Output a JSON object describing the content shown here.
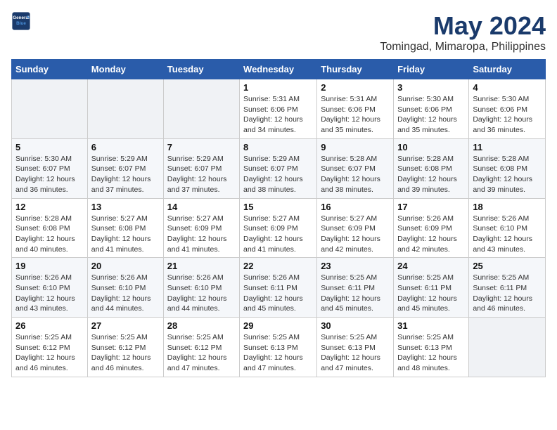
{
  "logo": {
    "line1": "General",
    "line2": "Blue"
  },
  "title": "May 2024",
  "subtitle": "Tomingad, Mimaropa, Philippines",
  "headers": [
    "Sunday",
    "Monday",
    "Tuesday",
    "Wednesday",
    "Thursday",
    "Friday",
    "Saturday"
  ],
  "weeks": [
    [
      {
        "day": "",
        "info": ""
      },
      {
        "day": "",
        "info": ""
      },
      {
        "day": "",
        "info": ""
      },
      {
        "day": "1",
        "info": "Sunrise: 5:31 AM\nSunset: 6:06 PM\nDaylight: 12 hours\nand 34 minutes."
      },
      {
        "day": "2",
        "info": "Sunrise: 5:31 AM\nSunset: 6:06 PM\nDaylight: 12 hours\nand 35 minutes."
      },
      {
        "day": "3",
        "info": "Sunrise: 5:30 AM\nSunset: 6:06 PM\nDaylight: 12 hours\nand 35 minutes."
      },
      {
        "day": "4",
        "info": "Sunrise: 5:30 AM\nSunset: 6:06 PM\nDaylight: 12 hours\nand 36 minutes."
      }
    ],
    [
      {
        "day": "5",
        "info": "Sunrise: 5:30 AM\nSunset: 6:07 PM\nDaylight: 12 hours\nand 36 minutes."
      },
      {
        "day": "6",
        "info": "Sunrise: 5:29 AM\nSunset: 6:07 PM\nDaylight: 12 hours\nand 37 minutes."
      },
      {
        "day": "7",
        "info": "Sunrise: 5:29 AM\nSunset: 6:07 PM\nDaylight: 12 hours\nand 37 minutes."
      },
      {
        "day": "8",
        "info": "Sunrise: 5:29 AM\nSunset: 6:07 PM\nDaylight: 12 hours\nand 38 minutes."
      },
      {
        "day": "9",
        "info": "Sunrise: 5:28 AM\nSunset: 6:07 PM\nDaylight: 12 hours\nand 38 minutes."
      },
      {
        "day": "10",
        "info": "Sunrise: 5:28 AM\nSunset: 6:08 PM\nDaylight: 12 hours\nand 39 minutes."
      },
      {
        "day": "11",
        "info": "Sunrise: 5:28 AM\nSunset: 6:08 PM\nDaylight: 12 hours\nand 39 minutes."
      }
    ],
    [
      {
        "day": "12",
        "info": "Sunrise: 5:28 AM\nSunset: 6:08 PM\nDaylight: 12 hours\nand 40 minutes."
      },
      {
        "day": "13",
        "info": "Sunrise: 5:27 AM\nSunset: 6:08 PM\nDaylight: 12 hours\nand 41 minutes."
      },
      {
        "day": "14",
        "info": "Sunrise: 5:27 AM\nSunset: 6:09 PM\nDaylight: 12 hours\nand 41 minutes."
      },
      {
        "day": "15",
        "info": "Sunrise: 5:27 AM\nSunset: 6:09 PM\nDaylight: 12 hours\nand 41 minutes."
      },
      {
        "day": "16",
        "info": "Sunrise: 5:27 AM\nSunset: 6:09 PM\nDaylight: 12 hours\nand 42 minutes."
      },
      {
        "day": "17",
        "info": "Sunrise: 5:26 AM\nSunset: 6:09 PM\nDaylight: 12 hours\nand 42 minutes."
      },
      {
        "day": "18",
        "info": "Sunrise: 5:26 AM\nSunset: 6:10 PM\nDaylight: 12 hours\nand 43 minutes."
      }
    ],
    [
      {
        "day": "19",
        "info": "Sunrise: 5:26 AM\nSunset: 6:10 PM\nDaylight: 12 hours\nand 43 minutes."
      },
      {
        "day": "20",
        "info": "Sunrise: 5:26 AM\nSunset: 6:10 PM\nDaylight: 12 hours\nand 44 minutes."
      },
      {
        "day": "21",
        "info": "Sunrise: 5:26 AM\nSunset: 6:10 PM\nDaylight: 12 hours\nand 44 minutes."
      },
      {
        "day": "22",
        "info": "Sunrise: 5:26 AM\nSunset: 6:11 PM\nDaylight: 12 hours\nand 45 minutes."
      },
      {
        "day": "23",
        "info": "Sunrise: 5:25 AM\nSunset: 6:11 PM\nDaylight: 12 hours\nand 45 minutes."
      },
      {
        "day": "24",
        "info": "Sunrise: 5:25 AM\nSunset: 6:11 PM\nDaylight: 12 hours\nand 45 minutes."
      },
      {
        "day": "25",
        "info": "Sunrise: 5:25 AM\nSunset: 6:11 PM\nDaylight: 12 hours\nand 46 minutes."
      }
    ],
    [
      {
        "day": "26",
        "info": "Sunrise: 5:25 AM\nSunset: 6:12 PM\nDaylight: 12 hours\nand 46 minutes."
      },
      {
        "day": "27",
        "info": "Sunrise: 5:25 AM\nSunset: 6:12 PM\nDaylight: 12 hours\nand 46 minutes."
      },
      {
        "day": "28",
        "info": "Sunrise: 5:25 AM\nSunset: 6:12 PM\nDaylight: 12 hours\nand 47 minutes."
      },
      {
        "day": "29",
        "info": "Sunrise: 5:25 AM\nSunset: 6:13 PM\nDaylight: 12 hours\nand 47 minutes."
      },
      {
        "day": "30",
        "info": "Sunrise: 5:25 AM\nSunset: 6:13 PM\nDaylight: 12 hours\nand 47 minutes."
      },
      {
        "day": "31",
        "info": "Sunrise: 5:25 AM\nSunset: 6:13 PM\nDaylight: 12 hours\nand 48 minutes."
      },
      {
        "day": "",
        "info": ""
      }
    ]
  ]
}
